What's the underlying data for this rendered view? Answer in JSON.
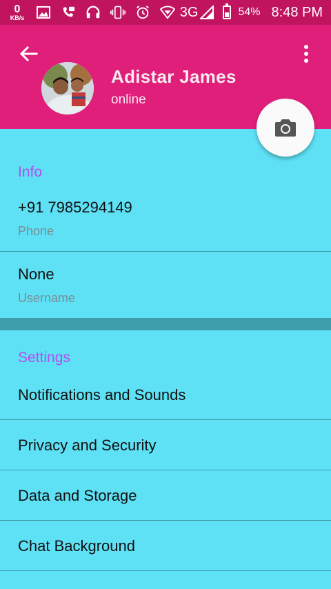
{
  "status_bar": {
    "net_speed_value": "0",
    "net_speed_unit": "KB/s",
    "network_type": "3G",
    "battery_percent": "54%",
    "time": "8:48 PM"
  },
  "header": {
    "name": "Adistar James",
    "status": "online"
  },
  "info": {
    "section_title": "Info",
    "phone": "+91 7985294149",
    "phone_label": "Phone",
    "username": "None",
    "username_label": "Username"
  },
  "settings": {
    "section_title": "Settings",
    "items": [
      {
        "label": "Notifications and Sounds"
      },
      {
        "label": "Privacy and Security"
      },
      {
        "label": "Data and Storage"
      },
      {
        "label": "Chat Background"
      }
    ]
  },
  "colors": {
    "status_bar": "#c0145f",
    "header": "#e01f7a",
    "background": "#5ee0f5",
    "section_title": "#b44ff0"
  },
  "icons": [
    "image-icon",
    "call-icon",
    "headset-icon",
    "vibrate-icon",
    "alarm-icon",
    "wifi-icon",
    "signal-icon",
    "battery-icon",
    "back-arrow-icon",
    "more-vert-icon",
    "camera-icon"
  ]
}
